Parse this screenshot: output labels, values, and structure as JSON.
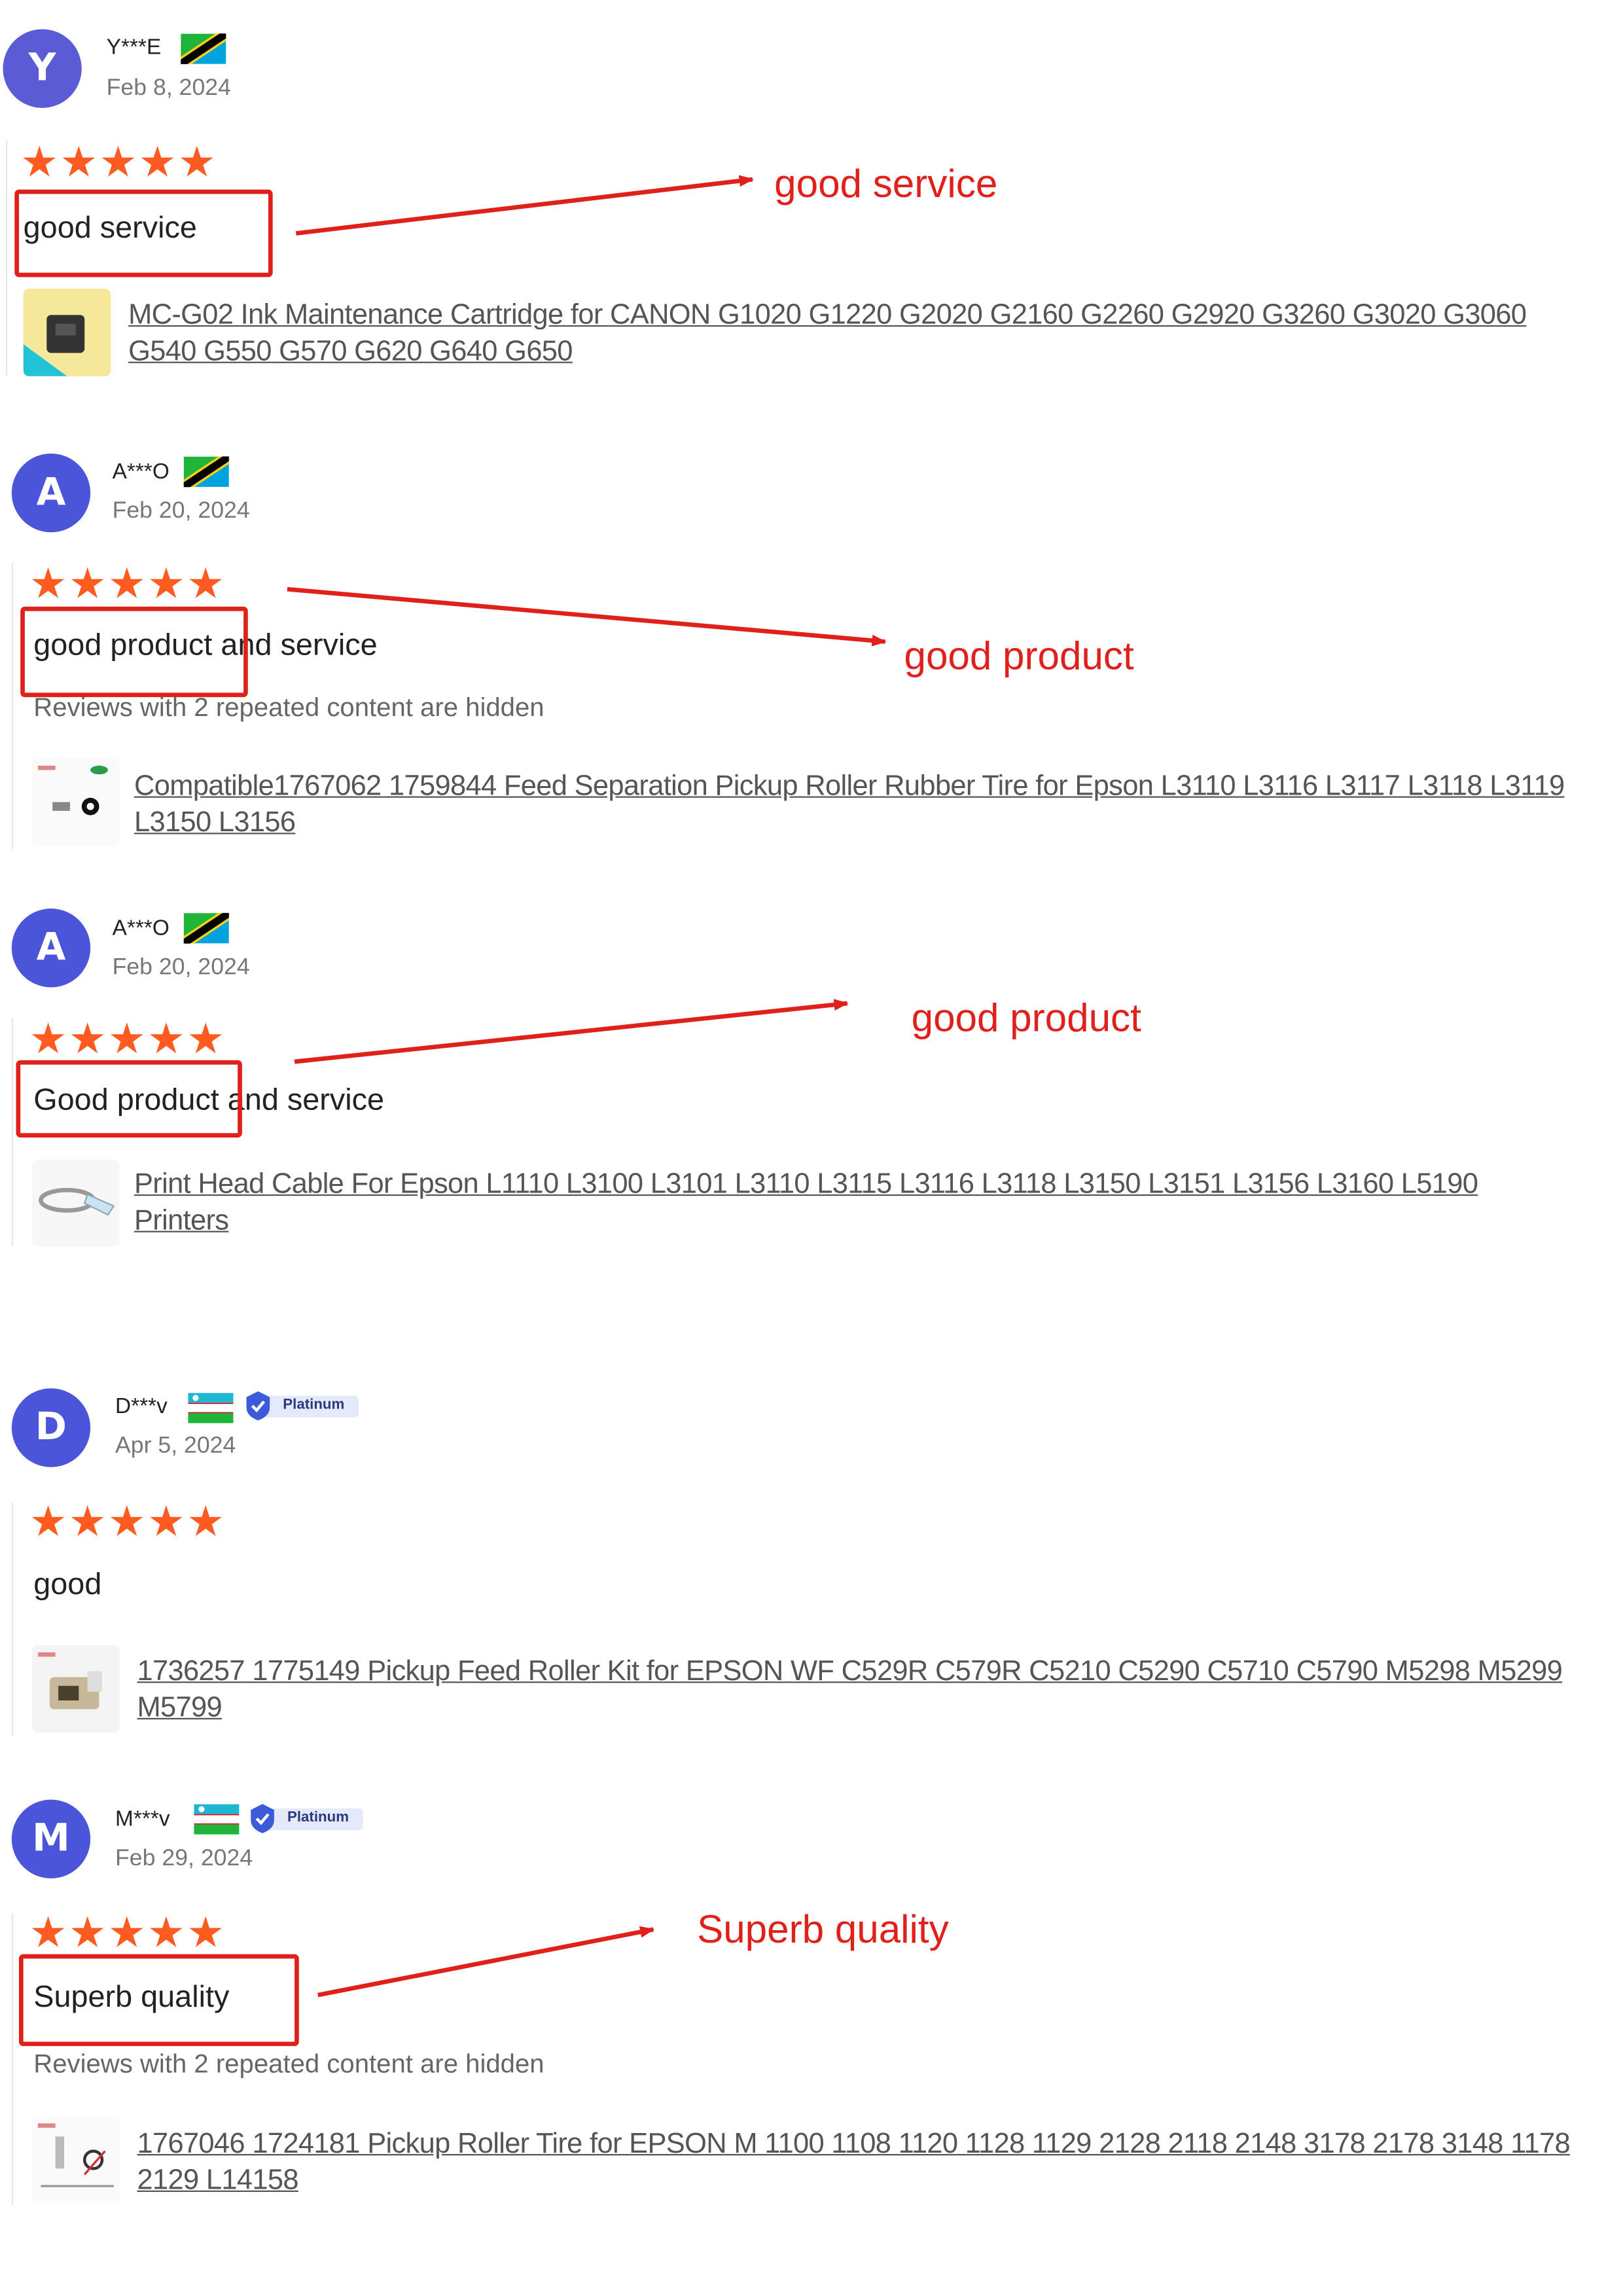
{
  "reviews": [
    {
      "initial": "Y",
      "avatar_color": "#5b5bd6",
      "user": "Y***E",
      "flag": "tanzania-flag-icon",
      "date": "Feb 8, 2024",
      "stars": "★★★★★",
      "text": "good service",
      "hidden_note": "",
      "product": "MC-G02 Ink Maintenance Cartridge for CANON G1020 G1220 G2020 G2160 G2260 G2920 G3260 G3020 G3060 G540 G550 G570 G620 G640 G650",
      "annotation": "good service"
    },
    {
      "initial": "A",
      "avatar_color": "#4a55d9",
      "user": "A***O",
      "flag": "tanzania-flag-icon",
      "date": "Feb 20, 2024",
      "stars": "★★★★★",
      "text": "good product and service",
      "hidden_note": "Reviews with 2 repeated content are hidden",
      "product": "Compatible1767062 1759844 Feed Separation Pickup Roller Rubber Tire for Epson L3110 L3116 L3117 L3118 L3119 L3150 L3156",
      "annotation": "good product"
    },
    {
      "initial": "A",
      "avatar_color": "#4a55d9",
      "user": "A***O",
      "flag": "tanzania-flag-icon",
      "date": "Feb 20, 2024",
      "stars": "★★★★★",
      "text": "Good product and service",
      "hidden_note": "",
      "product": "Print Head Cable For Epson L1110 L3100 L3101 L3110 L3115 L3116 L3118 L3150 L3151 L3156 L3160 L5190 Printers",
      "annotation": "good product"
    },
    {
      "initial": "D",
      "avatar_color": "#4a55d9",
      "user": "D***v",
      "flag": "uzbekistan-flag-icon",
      "badge": "Platinum",
      "date": "Apr 5, 2024",
      "stars": "★★★★★",
      "text": "good",
      "hidden_note": "",
      "product": "1736257 1775149 Pickup Feed Roller Kit for EPSON WF C529R C579R C5210 C5290 C5710 C5790 M5298 M5299 M5799",
      "annotation": ""
    },
    {
      "initial": "M",
      "avatar_color": "#4a55d9",
      "user": "M***v",
      "flag": "uzbekistan-flag-icon",
      "badge": "Platinum",
      "date": "Feb 29, 2024",
      "stars": "★★★★★",
      "text": "Superb quality",
      "hidden_note": "Reviews with 2 repeated content are hidden",
      "product": "1767046 1724181 Pickup Roller Tire for EPSON M 1100 1108 1120 1128 1129 2128 2118 2148 3178 2178 3148 1178 2129 L14158",
      "annotation": "Superb quality"
    }
  ],
  "colors": {
    "star": "#ff5a1f",
    "annotation_red": "#e0201b",
    "badge_blue": "#3b5bdb"
  }
}
